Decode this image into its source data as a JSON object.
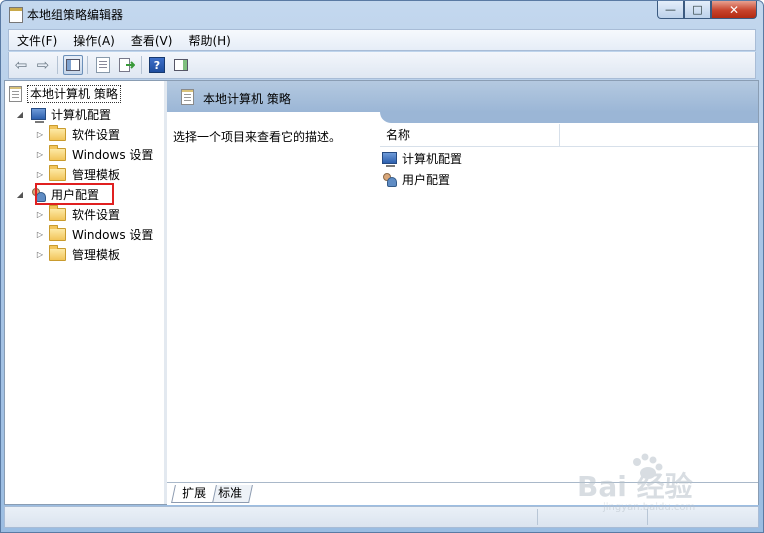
{
  "window": {
    "title": "本地组策略编辑器",
    "caption_buttons": {
      "minimize": "—",
      "maximize": "□",
      "close": "✕"
    }
  },
  "menu": [
    {
      "label": "文件(F)"
    },
    {
      "label": "操作(A)"
    },
    {
      "label": "查看(V)"
    },
    {
      "label": "帮助(H)"
    }
  ],
  "toolbar": {
    "back_glyph": "⇦",
    "forward_glyph": "⇨",
    "export_glyph": "➔",
    "help_glyph": "?"
  },
  "tree": {
    "root": {
      "label": "本地计算机 策略",
      "icon": "policy-icon"
    },
    "computer": {
      "label": "计算机配置",
      "arrow": "◢",
      "icon": "computer-icon",
      "children": [
        {
          "label": "软件设置",
          "arrow": "▷"
        },
        {
          "label": "Windows 设置",
          "arrow": "▷"
        },
        {
          "label": "管理模板",
          "arrow": "▷"
        }
      ]
    },
    "user": {
      "label": "用户配置",
      "arrow": "◢",
      "icon": "users-icon",
      "children": [
        {
          "label": "软件设置",
          "arrow": "▷"
        },
        {
          "label": "Windows 设置",
          "arrow": "▷"
        },
        {
          "label": "管理模板",
          "arrow": "▷"
        }
      ]
    }
  },
  "content": {
    "header_title": "本地计算机 策略",
    "description": "选择一个项目来查看它的描述。",
    "columns": [
      "名称"
    ],
    "items": [
      {
        "label": "计算机配置",
        "icon": "computer-icon"
      },
      {
        "label": "用户配置",
        "icon": "users-icon"
      }
    ],
    "tabs": [
      {
        "label": "扩展",
        "active": true
      },
      {
        "label": "标准",
        "active": false
      }
    ]
  },
  "watermark": {
    "text": "Bai 经验",
    "sub": "jingyan.baidu.com"
  },
  "colors": {
    "highlight": "#e02020",
    "header": "#9bb6d6"
  }
}
